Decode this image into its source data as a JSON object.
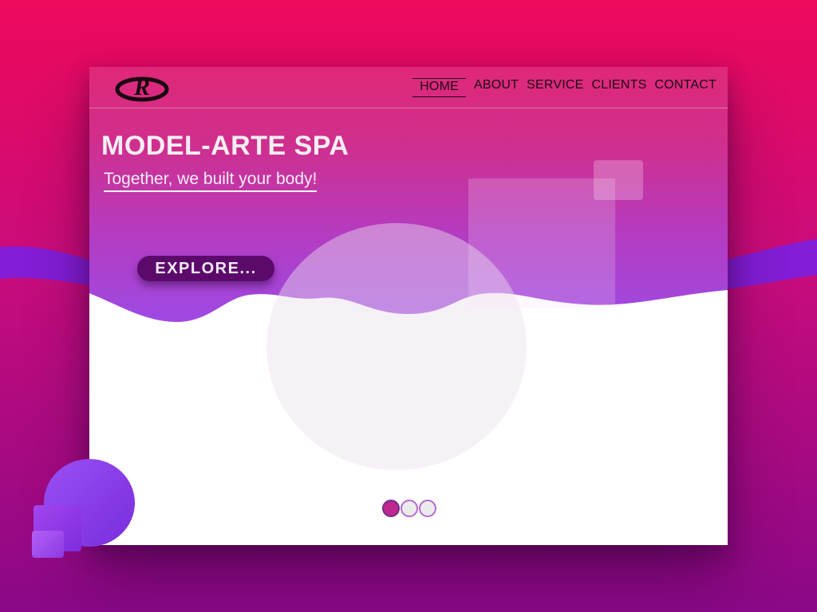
{
  "brand": {
    "logo_icon": "r-monogram-logo"
  },
  "nav": {
    "items": [
      {
        "label": "HOME",
        "active": true
      },
      {
        "label": "ABOUT",
        "active": false
      },
      {
        "label": "SERVICE",
        "active": false
      },
      {
        "label": "CLIENTS",
        "active": false
      },
      {
        "label": "CONTACT",
        "active": false
      }
    ]
  },
  "hero": {
    "title": "MODEL-ARTE SPA",
    "subtitle": "Together, we built your body!",
    "cta_label": "EXPLORE..."
  },
  "carousel": {
    "slide_count": 3,
    "active_index": 0
  },
  "colors": {
    "background_top": "#ee0a5c",
    "background_bottom": "#8a0887",
    "hero_top": "#e02878",
    "hero_bottom": "#9c4be6",
    "cta_button": "#5b0a6c",
    "active_dot": "#c0278f",
    "accent_purple": "#7a2ddd"
  }
}
